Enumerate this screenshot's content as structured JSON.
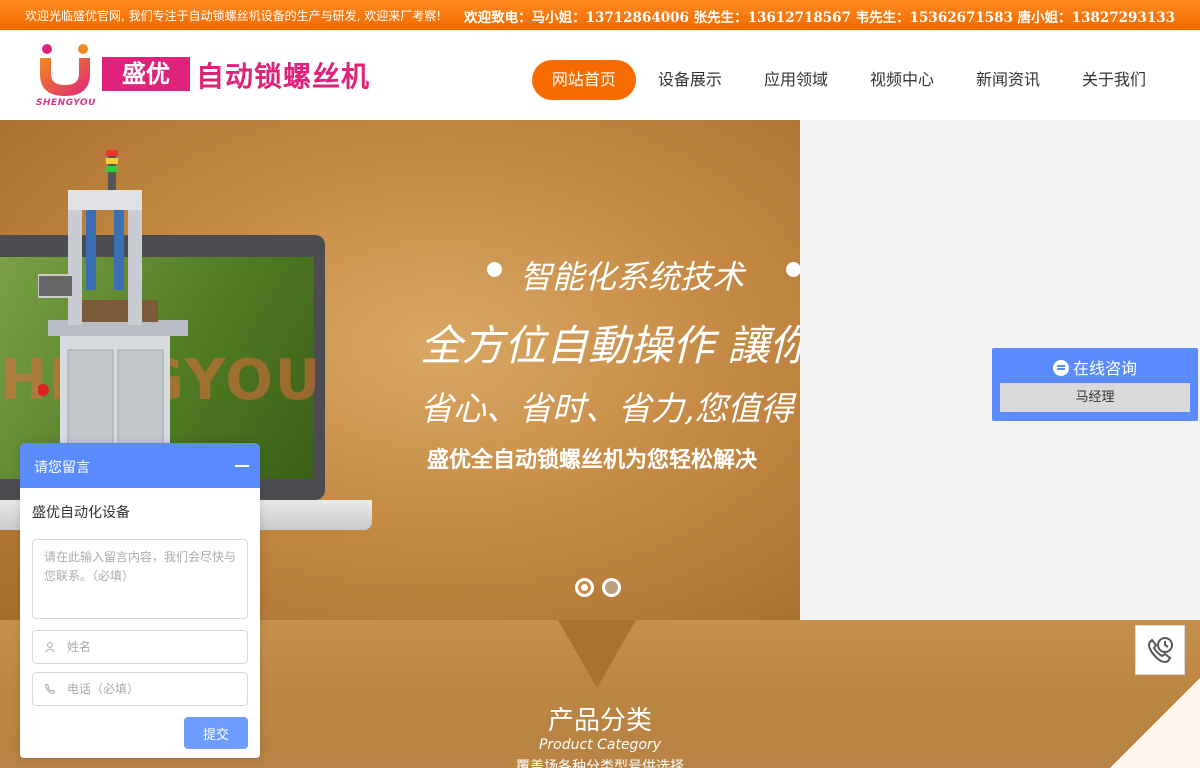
{
  "topbar": {
    "welcome": "欢迎光临盛优官网, 我们专注于自动锁螺丝机设备的生产与研发, 欢迎来厂考察!",
    "contacts": "欢迎致电：马小姐：13712864006  张先生：13612718567  韦先生：15362671583  唐小姐：13827293133"
  },
  "logo": {
    "subtext": "SHENGYOU",
    "brand": "盛优",
    "title": "自动锁螺丝机"
  },
  "nav": {
    "items": [
      {
        "label": "网站首页",
        "active": true
      },
      {
        "label": "设备展示",
        "active": false
      },
      {
        "label": "应用领域",
        "active": false
      },
      {
        "label": "视频中心",
        "active": false
      },
      {
        "label": "新闻资讯",
        "active": false
      },
      {
        "label": "关于我们",
        "active": false
      }
    ]
  },
  "banner": {
    "watermark": "HENGYOU",
    "slogan1": "智能化系统技术",
    "slogan2": "全方位自動操作  讓你",
    "slogan3": "省心、省时、省力,您值得",
    "slogan4": "盛优全自动锁螺丝机为您轻松解决",
    "slides": 2,
    "active_slide": 1
  },
  "category": {
    "title": "产品分类",
    "subtitle": "Product Category",
    "desc": "覆盖场各种分类型号供选择"
  },
  "consult": {
    "title": "在线咨询",
    "person": "马经理",
    "icon": "chat-bubble-icon"
  },
  "phone_button": {
    "icon": "phone-clock-icon"
  },
  "message": {
    "title": "请您留言",
    "company": "盛优自动化设备",
    "textarea_placeholder": "请在此输入留言内容，我们会尽快与您联系。（必填）",
    "name_placeholder": "姓名",
    "phone_placeholder": "电话（必填）",
    "submit": "提交"
  },
  "colors": {
    "orange": "#f76b00",
    "brand_pink": "#e0237a",
    "widget_blue": "#5a8cff",
    "banner_gold": "#c58b46"
  }
}
